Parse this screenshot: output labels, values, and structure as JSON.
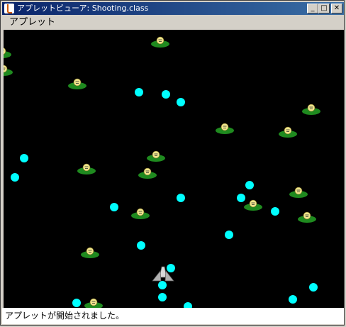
{
  "window": {
    "title": "アプレットビューア: Shooting.class",
    "controls": {
      "minimize": "_",
      "maximize": "□",
      "close": "✕"
    }
  },
  "menu": {
    "items": [
      "アプレット"
    ]
  },
  "status": {
    "text": "アプレットが開始されました。"
  },
  "colors": {
    "canvas_bg": "#000000",
    "bullet": "#00ffff",
    "enemy_base": "#1f8a1f",
    "enemy_head": "#f0e68c",
    "player": "#b0b0b0"
  }
}
